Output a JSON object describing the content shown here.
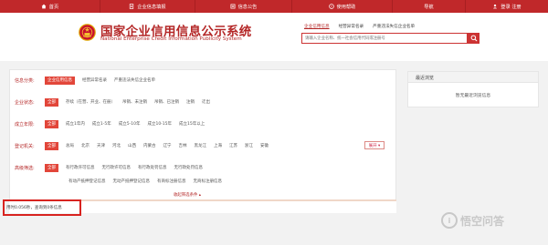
{
  "nav": {
    "items": [
      {
        "label": "首页",
        "icon": "home-icon"
      },
      {
        "label": "企业信息填报",
        "icon": "document-icon"
      },
      {
        "label": "信息公告",
        "icon": "notice-icon"
      },
      {
        "label": "使用帮助",
        "icon": "help-icon"
      },
      {
        "label": "导航",
        "icon": ""
      },
      {
        "label": "登录 注册",
        "icon": "user-icon"
      }
    ],
    "bg_color": "#c0282a"
  },
  "header": {
    "title_cn": "国家企业信用信息公示系统",
    "title_en": "National Enterprise Credit Information Publicity System",
    "search_tabs": [
      "企业信用信息",
      "经营异常名录",
      "严重违法失信企业名单"
    ],
    "search_placeholder": "请输入企业名称、统一社会信用代码或注册号",
    "accent_color": "#b42727"
  },
  "filters": {
    "rows": [
      {
        "label": "信息分类:",
        "options": [
          "企业信用信息",
          "经营异常名录",
          "严重违法失信企业名单"
        ],
        "selected": 0
      },
      {
        "label": "企业状态:",
        "options": [
          "全部",
          "存续（在营、开业、在册）",
          "吊销、未注销",
          "吊销、已注销",
          "注销",
          "迁出"
        ],
        "selected": 0
      },
      {
        "label": "成立年限:",
        "options": [
          "全部",
          "成立1年内",
          "成立1-5年",
          "成立5-10年",
          "成立10-15年",
          "成立15年以上"
        ],
        "selected": 0
      },
      {
        "label": "登记机关:",
        "options": [
          "全部",
          "总局",
          "北京",
          "天津",
          "河北",
          "山西",
          "内蒙古",
          "辽宁",
          "吉林",
          "黑龙江",
          "上海",
          "江苏",
          "浙江",
          "安徽"
        ],
        "selected": 0
      },
      {
        "label": "高级筛选:",
        "options": [
          "全部",
          "有行政许可信息",
          "无行政许可信息",
          "有行政处罚信息",
          "无行政处罚信息"
        ],
        "selected": 0
      }
    ],
    "advanced_second_line": [
      "有动产抵押登记信息",
      "无动产抵押登记信息",
      "有商标注册信息",
      "无商标注册信息"
    ],
    "expand_label": "展开 ▾",
    "collapse_label": "收起筛选条件 ▴",
    "status_text": "用时0.056秒，查询到0条信息"
  },
  "recent": {
    "title": "最近浏览",
    "empty_text": "暂无最近浏览信息"
  },
  "watermark": {
    "text": "悟空问答",
    "mark": "i"
  }
}
